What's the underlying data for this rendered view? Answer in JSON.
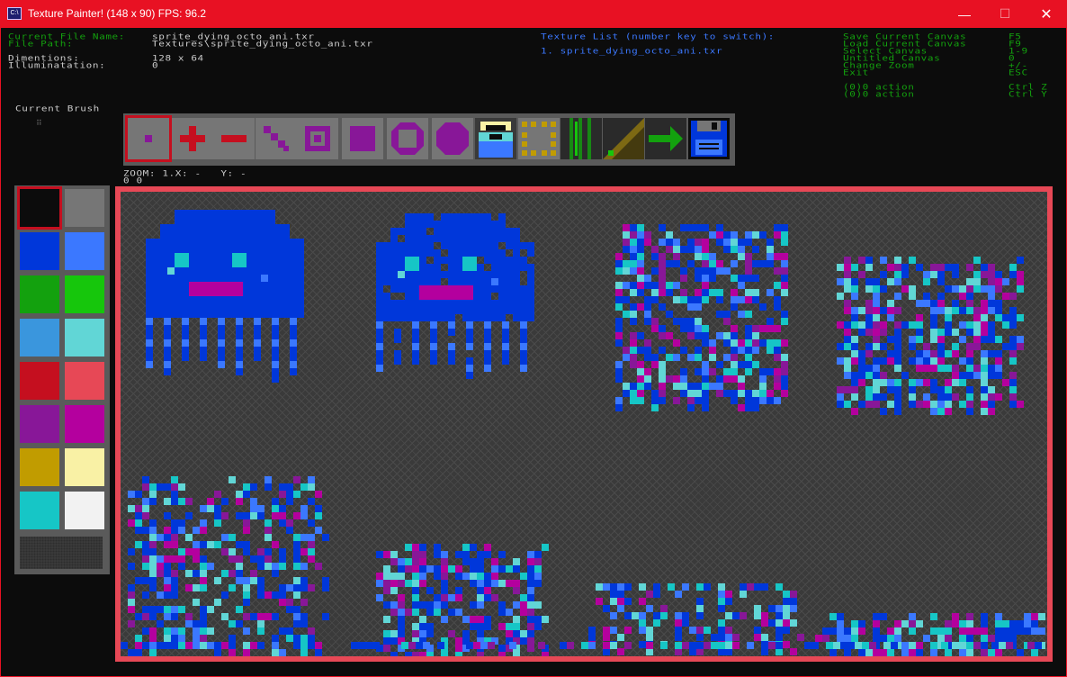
{
  "window": {
    "title": "Texture Painter! (148 x 90) FPS: 96.2",
    "icon": "console-icon",
    "minimize": "—",
    "maximize": "☐",
    "close": "✕"
  },
  "info": {
    "file_name_label": "Current File Name:",
    "file_name": "sprite_dying_octo_ani.txr",
    "file_path_label": "File Path:",
    "file_path": "Textures\\sprite_dying_octo_ani.txr",
    "dimensions_label": "Dimentions:",
    "dimensions": "128 x 64",
    "illumination_label": "Illuminatation:",
    "illumination": "0"
  },
  "texture_list": {
    "header": "Texture List (number key to switch):",
    "items": [
      "1. sprite_dying_octo_ani.txr"
    ]
  },
  "shortcuts": [
    {
      "action": "Save Current Canvas",
      "key": "F5"
    },
    {
      "action": "Load Current Canvas",
      "key": "F9"
    },
    {
      "action": "Select Canvas",
      "key": "1-9"
    },
    {
      "action": "Untitled Canvas",
      "key": "0"
    },
    {
      "action": "Change Zoom",
      "key": "+/-"
    },
    {
      "action": "Exit",
      "key": "ESC"
    },
    {
      "action": "(0)0 action",
      "key": "Ctrl Z"
    },
    {
      "action": "(0)0 action",
      "key": "Ctrl Y"
    }
  ],
  "brush": {
    "label": "Current Brush",
    "glyph": "⠿"
  },
  "zoom": {
    "text": "ZOOM: 1.X: -   Y: -",
    "coords": "0 0"
  },
  "tools": [
    {
      "name": "pixel-brush-icon"
    },
    {
      "name": "plus-brush-icon"
    },
    {
      "name": "horizontal-line-icon"
    },
    {
      "name": "diagonal-line-icon"
    },
    {
      "name": "hollow-square-icon"
    },
    {
      "name": "filled-square-icon"
    },
    {
      "name": "hollow-octagon-icon"
    },
    {
      "name": "filled-octagon-icon"
    },
    {
      "name": "character-brush-icon"
    },
    {
      "name": "dotted-frame-icon"
    },
    {
      "name": "dither-icon"
    },
    {
      "name": "gradient-icon"
    },
    {
      "name": "arrow-icon"
    },
    {
      "name": "save-disk-icon"
    }
  ],
  "palette": [
    "#0c0c0c",
    "#767676",
    "#0037da",
    "#3b78ff",
    "#13a10e",
    "#16c60c",
    "#3a96dd",
    "#61d6d6",
    "#c50f1f",
    "#e74856",
    "#881798",
    "#b4009e",
    "#c19c00",
    "#f9f1a5",
    "#16c6c6",
    "#f2f2f2"
  ],
  "colors": {
    "title_bar": "#e81123",
    "label_green": "#13a10e",
    "value_white": "#cccccc",
    "list_blue": "#3b78ff",
    "canvas_border": "#e74856"
  }
}
